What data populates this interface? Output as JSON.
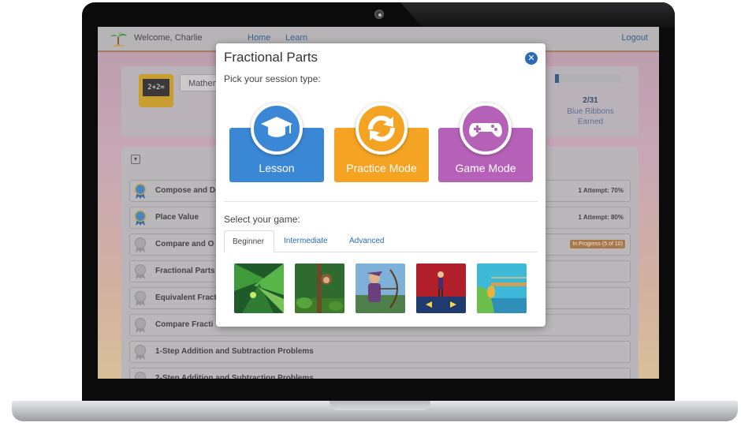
{
  "header": {
    "welcome": "Welcome, Charlie",
    "nav": [
      "Home",
      "Learn"
    ],
    "logout": "Logout"
  },
  "panel": {
    "chalkboard_text": "2+2=",
    "subject": "Mathen",
    "ribbons_count": "2/31",
    "ribbons_label_1": "Blue Ribbons",
    "ribbons_label_2": "Earned",
    "progress_fraction": 0.065
  },
  "lessons": [
    {
      "title": "Compose and De",
      "status": "1 Attempt: 70%",
      "ribbon": "blue"
    },
    {
      "title": "Place Value",
      "status": "1 Attempt: 80%",
      "ribbon": "blue"
    },
    {
      "title": "Compare and O",
      "badge": "In Progress (5 of 10)",
      "ribbon": "gray"
    },
    {
      "title": "Fractional Parts",
      "ribbon": "gray"
    },
    {
      "title": "Equivalent Fract",
      "ribbon": "gray"
    },
    {
      "title": "Compare Fracti",
      "ribbon": "gray"
    },
    {
      "title": "1-Step Addition and Subtraction Problems",
      "ribbon": "gray"
    },
    {
      "title": "2-Step Addition and Subtraction Problems",
      "ribbon": "gray"
    }
  ],
  "modal": {
    "title": "Fractional Parts",
    "close_icon": "close-icon",
    "pick_session": "Pick your session type:",
    "sessions": [
      {
        "label": "Lesson",
        "icon": "graduation-cap-icon",
        "color": "#3a87d6"
      },
      {
        "label": "Practice Mode",
        "icon": "refresh-icon",
        "color": "#f4a323"
      },
      {
        "label": "Game Mode",
        "icon": "gamepad-icon",
        "color": "#b561b8"
      }
    ],
    "select_game": "Select your game:",
    "tabs": [
      "Beginner",
      "Intermediate",
      "Advanced"
    ],
    "active_tab": "Beginner",
    "games": [
      {
        "name": "jungle-leaf-game",
        "icon": "leaf-scene-icon"
      },
      {
        "name": "monkey-game",
        "icon": "monkey-scene-icon"
      },
      {
        "name": "archer-game",
        "icon": "archer-scene-icon"
      },
      {
        "name": "stage-game",
        "icon": "stage-scene-icon"
      },
      {
        "name": "bridge-game",
        "icon": "bridge-scene-icon"
      }
    ]
  }
}
